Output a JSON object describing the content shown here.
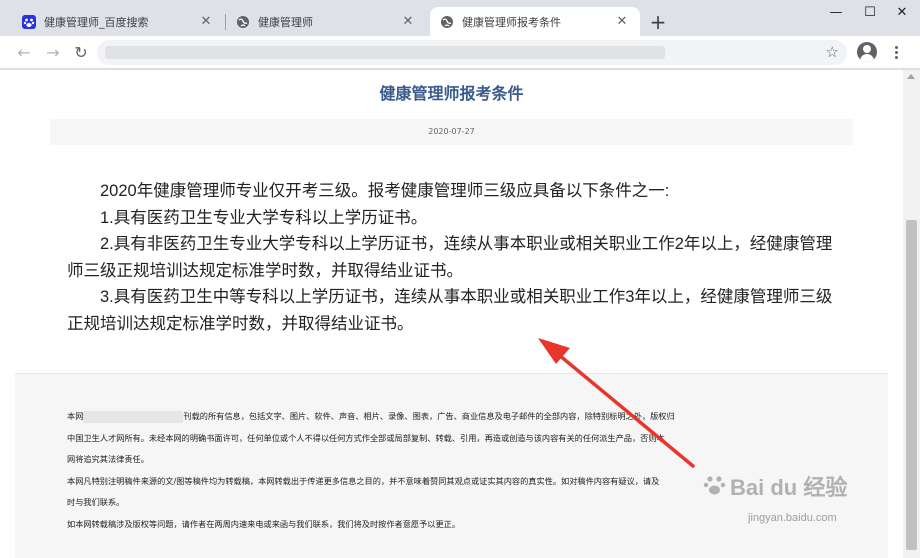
{
  "browser": {
    "tabs": [
      {
        "title": "健康管理师_百度搜索",
        "icon": "baidu-paw-icon",
        "active": false
      },
      {
        "title": "健康管理师",
        "icon": "globe-icon",
        "active": false
      },
      {
        "title": "健康管理师报考条件",
        "icon": "globe-icon",
        "active": true
      }
    ],
    "new_tab": "+",
    "window": {
      "minimize": "—",
      "maximize": "☐",
      "close": "✕"
    },
    "nav": {
      "back": "←",
      "forward": "→",
      "reload": "↻",
      "star": "☆"
    }
  },
  "article": {
    "title": "健康管理师报考条件",
    "date": "2020-07-27",
    "paragraphs": [
      "2020年健康管理师专业仅开考三级。报考健康管理师三级应具备以下条件之一:",
      "1.具有医药卫生专业大学专科以上学历证书。",
      "2.具有非医药卫生专业大学专科以上学历证书，连续从事本职业或相关职业工作2年以上，经健康管理师三级正规培训达规定标准学时数，并取得结业证书。",
      "3.具有医药卫生中等专科以上学历证书，连续从事本职业或相关职业工作3年以上，经健康管理师三级正规培训达规定标准学时数，并取得结业证书。"
    ]
  },
  "footer": {
    "line1_prefix": "本网",
    "line1_rest": "刊载的所有信息，包括文字、图片、软件、声音、相片、录像、图表，广告、商业信息及电子邮件的全部内容，除特别标明之外，版权归",
    "line2": "中国卫生人才网所有。未经本网的明确书面许可，任何单位或个人不得以任何方式作全部或局部复制、转载、引用，再造或创造与该内容有关的任何派生产品，否则本",
    "line3": "网将追究其法律责任。",
    "line4": "本网凡特别注明稿件来源的文/图等稿件均为转载稿，本网转载出于传递更多信息之目的，并不意味着赞同其观点或证实其内容的真实性。如对稿件内容有疑议，请及",
    "line5": "时与我们联系。",
    "line6": "如本网转载稿涉及版权等问题，请作者在两周内速来电或来函与我们联系，我们将及时按作者意愿予以更正。"
  },
  "watermark": {
    "logo": "Bai du 经验",
    "url": "jingyan.baidu.com"
  },
  "colors": {
    "title": "#3a5a8c",
    "arrow": "#e8352e"
  }
}
